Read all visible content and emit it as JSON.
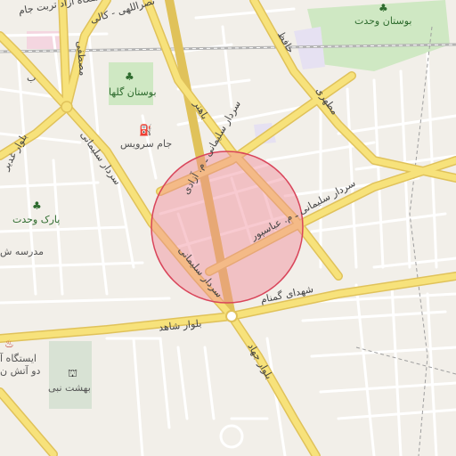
{
  "colors": {
    "background": "#f2efe9",
    "minor_road": "#ffffff",
    "major_road_fill": "#f7e27b",
    "major_road_casing": "#e0c25a",
    "park": "#cfe8c3",
    "railway": "#b4b4b4",
    "boundary": "#c9c9c9",
    "radius_fill": "#f08a96",
    "radius_stroke": "#d9455a",
    "poi_icon": "#333333"
  },
  "labels": {
    "darya_street": "دانشگاه آزاد تربت جام",
    "nasrollahi": "نصراللهی - کالی",
    "mostafa": "مصطفی",
    "hafez": "حافظ",
    "motahari": "مطهری",
    "bahonar": "باهنر",
    "boostan_vahdat": "بوستان وحدت",
    "boostan_golha": "بوستان گلها",
    "jam_services": "جام سرویس",
    "soleimani_azadi": "سردار سلیمانی ـ م. آزادی",
    "soleimani_north": "سردار سلیمانی",
    "soleimani_abbaspour": "سردار سلیمانی ـ م. عباسپور",
    "soleimani_south": "سردار سلیمانی",
    "bolvar_ghadir": "بلوار غدیر",
    "park_vahdat": "پارک وحدت",
    "madrese": "مدرسه ش",
    "shohada_gomnam": "شهدای گمنام",
    "bolvar_shahed": "بلوار شاهد",
    "bolvar_jehad": "بلوار جهاد",
    "fire_station": "ایستگاه آ",
    "fire_station_2": "دو آتش ن",
    "behesht_nabi": "بهشت نبی",
    "edge_label": "ب"
  },
  "icons": {
    "tree": "tree-icon",
    "fuel": "fuel-icon",
    "fire": "fire-station-icon",
    "cemetery": "cemetery-icon"
  }
}
